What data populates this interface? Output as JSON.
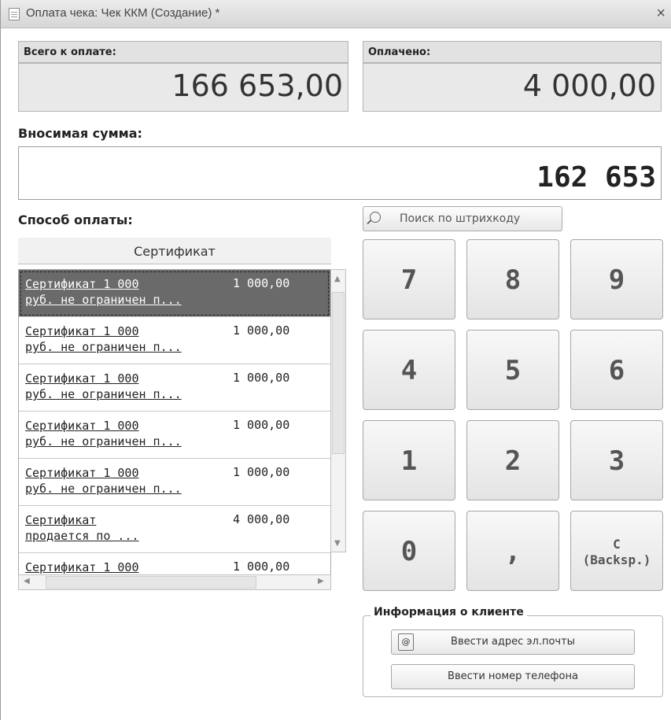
{
  "window": {
    "title": "Оплата чека: Чек ККМ (Создание) *",
    "close": "×"
  },
  "totals": {
    "total_label": "Всего к оплате:",
    "total_value": "166 653,00",
    "paid_label": "Оплачено:",
    "paid_value": "4 000,00"
  },
  "deposit": {
    "label": "Вносимая сумма:",
    "value": "162 653"
  },
  "payment_method": {
    "label": "Способ оплаты:",
    "column_header": "Сертификат",
    "rows": [
      {
        "name_line1": "Сертификат 1 000",
        "name_line2": "руб. не ограничен п...",
        "amount": "1 000,00"
      },
      {
        "name_line1": "Сертификат 1 000",
        "name_line2": "руб. не ограничен п...",
        "amount": "1 000,00"
      },
      {
        "name_line1": "Сертификат 1 000",
        "name_line2": "руб. не ограничен п...",
        "amount": "1 000,00"
      },
      {
        "name_line1": "Сертификат 1 000",
        "name_line2": "руб. не ограничен п...",
        "amount": "1 000,00"
      },
      {
        "name_line1": "Сертификат 1 000",
        "name_line2": "руб. не ограничен п...",
        "amount": "1 000,00"
      },
      {
        "name_line1": "Сертификат",
        "name_line2": "продается по ...",
        "amount": "4 000,00"
      },
      {
        "name_line1": "Сертификат 1 000",
        "name_line2": "",
        "amount": "1 000,00"
      }
    ]
  },
  "search": {
    "label": "Поиск по штрихкоду",
    "icon": "search-icon"
  },
  "keypad": {
    "k7": "7",
    "k8": "8",
    "k9": "9",
    "k4": "4",
    "k5": "5",
    "k6": "6",
    "k1": "1",
    "k2": "2",
    "k3": "3",
    "k0": "0",
    "comma": ",",
    "backspace_line1": "C",
    "backspace_line2": "(Backsp.)"
  },
  "client_info": {
    "legend": "Информация о клиенте",
    "email_button": "Ввести адрес эл.почты",
    "phone_button": "Ввести номер телефона",
    "email_icon": "@"
  }
}
